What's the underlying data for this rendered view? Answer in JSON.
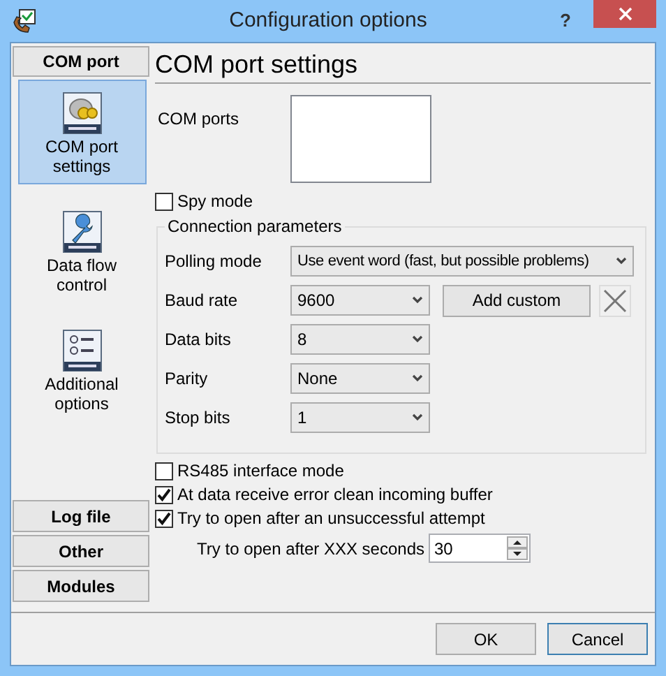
{
  "window": {
    "title": "Configuration options",
    "help": "?"
  },
  "sidebar": {
    "group": "COM port",
    "items": [
      {
        "label": "COM port settings",
        "kind": "plug",
        "selected": true
      },
      {
        "label": "Data flow control",
        "kind": "wrench",
        "selected": false
      },
      {
        "label": "Additional options",
        "kind": "list",
        "selected": false
      }
    ],
    "groups": [
      "Log file",
      "Other",
      "Modules"
    ]
  },
  "heading": "COM port settings",
  "com_ports": {
    "label": "COM ports"
  },
  "spy_mode": {
    "label": "Spy mode",
    "checked": false
  },
  "connection": {
    "title": "Connection parameters",
    "rows": [
      {
        "label": "Polling mode",
        "value": "Use event word (fast, but possible problems)",
        "kind": "wide"
      },
      {
        "label": "Baud rate",
        "value": "9600",
        "kind": "narrow",
        "button": "Add custom"
      },
      {
        "label": "Data bits",
        "value": "8",
        "kind": "narrow"
      },
      {
        "label": "Parity",
        "value": "None",
        "kind": "narrow"
      },
      {
        "label": "Stop bits",
        "value": "1",
        "kind": "narrow"
      }
    ]
  },
  "options": [
    {
      "label": "RS485 interface mode",
      "checked": false
    },
    {
      "label": "At data receive error clean incoming buffer",
      "checked": true
    },
    {
      "label": "Try to open after an unsuccessful attempt",
      "checked": true
    }
  ],
  "retry": {
    "label": "Try to open after XXX seconds",
    "value": "30"
  },
  "buttons": [
    {
      "label": "OK",
      "focused": false
    },
    {
      "label": "Cancel",
      "focused": true
    }
  ]
}
